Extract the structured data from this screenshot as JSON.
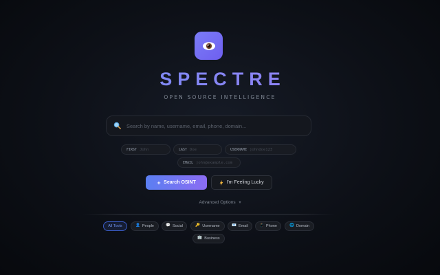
{
  "brand": {
    "title": "SPECTRE",
    "tagline": "OPEN SOURCE INTELLIGENCE",
    "logo_icon": "eye-icon",
    "accent_from": "#6f8ff5",
    "accent_to": "#9d7cf4"
  },
  "search": {
    "placeholder": "Search by name, username, email, phone, domain...",
    "value": "",
    "icon": "search-icon"
  },
  "fields": {
    "first": {
      "label": "FIRST",
      "placeholder": "John"
    },
    "last": {
      "label": "LAST",
      "placeholder": "Doe"
    },
    "username": {
      "label": "USERNAME",
      "placeholder": "johndoe123"
    },
    "email": {
      "label": "EMAIL",
      "placeholder": "john@example.com"
    }
  },
  "actions": {
    "search_label": "Search OSINT",
    "lucky_label": "I'm Feeling Lucky"
  },
  "advanced": {
    "label": "Advanced Options",
    "chevron": "▾"
  },
  "categories": [
    {
      "label": "All Tools",
      "icon": "",
      "active": true
    },
    {
      "label": "People",
      "icon": "👤",
      "active": false
    },
    {
      "label": "Social",
      "icon": "💬",
      "active": false
    },
    {
      "label": "Username",
      "icon": "🔑",
      "active": false
    },
    {
      "label": "Email",
      "icon": "📧",
      "active": false
    },
    {
      "label": "Phone",
      "icon": "📱",
      "active": false
    },
    {
      "label": "Domain",
      "icon": "🌐",
      "active": false
    },
    {
      "label": "Business",
      "icon": "🏢",
      "active": false
    }
  ]
}
